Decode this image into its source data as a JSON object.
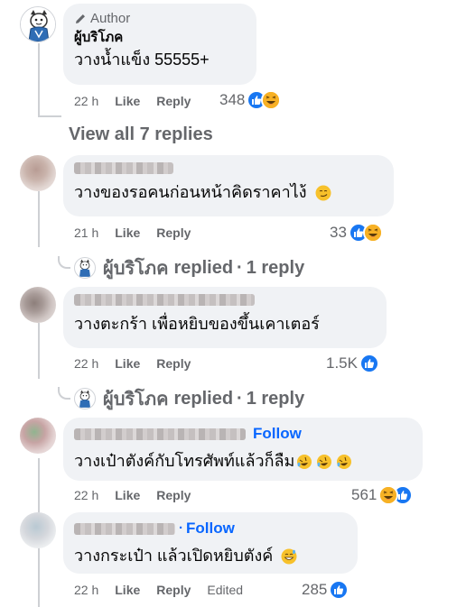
{
  "comments": [
    {
      "badge": "Author",
      "name": "ผู้บริโภค",
      "text": "วางน้ำแข็ง 55555+",
      "time": "22 h",
      "like": "Like",
      "reply": "Reply",
      "reaction_count": "348",
      "reactions": [
        "like-icon",
        "haha-icon"
      ]
    },
    {
      "name": "",
      "text": "วางของรอคนก่อนหน้าคิดราคาไง้",
      "time": "21 h",
      "like": "Like",
      "reply": "Reply",
      "reaction_count": "33",
      "reactions": [
        "like-icon",
        "haha-icon"
      ]
    },
    {
      "name": "",
      "text": "วางตะกร้า เพื่อหยิบของขึ้นเคาเตอร์",
      "time": "22 h",
      "like": "Like",
      "reply": "Reply",
      "reaction_count": "1.5K",
      "reactions": [
        "like-icon"
      ]
    },
    {
      "name": "",
      "follow": "Follow",
      "text": "วางเป๋าตังค์กับโทรศัพท์แล้วก็ลืม",
      "time": "22 h",
      "like": "Like",
      "reply": "Reply",
      "reaction_count": "561",
      "reactions": [
        "haha-icon",
        "like-icon"
      ]
    },
    {
      "name": "",
      "follow": "Follow",
      "follow_sep": "·",
      "text": "วางกระเป๋า แล้วเปิดหยิบตังค์",
      "time": "22 h",
      "like": "Like",
      "reply": "Reply",
      "edited": "Edited",
      "reaction_count": "285",
      "reactions": [
        "like-icon"
      ]
    }
  ],
  "view_all_replies": "View all 7 replies",
  "reply_summaries": [
    {
      "name": "ผู้บริโภค",
      "replied": "replied",
      "sep": "·",
      "count": "1 reply"
    },
    {
      "name": "ผู้บริโภค",
      "replied": "replied",
      "sep": "·",
      "count": "1 reply"
    }
  ],
  "colors": {
    "like": "#1877f2",
    "haha": "#f7b125",
    "follow": "#0866ff",
    "bubble": "#f0f2f5",
    "meta": "#65676b"
  }
}
